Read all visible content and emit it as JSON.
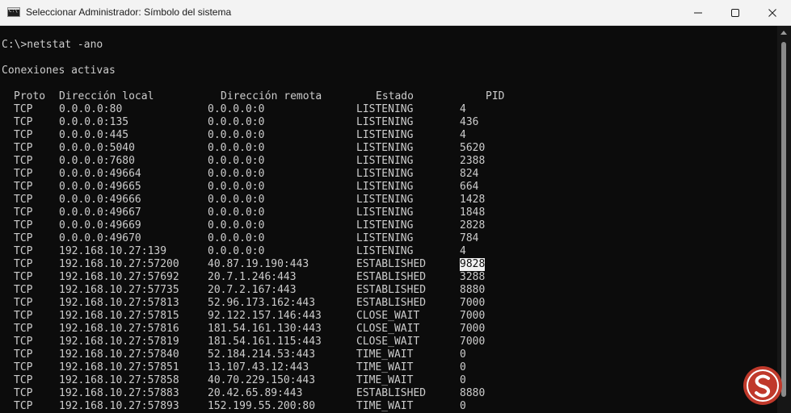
{
  "window": {
    "title": "Seleccionar Administrador: Símbolo del sistema",
    "minimize_icon": "minimize-icon",
    "maximize_icon": "maximize-icon",
    "close_icon": "close-icon"
  },
  "console": {
    "command_line": "C:\\>netstat -ano",
    "section_title": "Conexiones activas",
    "headers": {
      "proto": "Proto",
      "local": "Dirección local",
      "remote": "Dirección remota",
      "state": "Estado",
      "pid": "PID"
    },
    "rows": [
      {
        "proto": "TCP",
        "local": "0.0.0.0:80",
        "remote": "0.0.0.0:0",
        "state": "LISTENING",
        "pid": "4"
      },
      {
        "proto": "TCP",
        "local": "0.0.0.0:135",
        "remote": "0.0.0.0:0",
        "state": "LISTENING",
        "pid": "436"
      },
      {
        "proto": "TCP",
        "local": "0.0.0.0:445",
        "remote": "0.0.0.0:0",
        "state": "LISTENING",
        "pid": "4"
      },
      {
        "proto": "TCP",
        "local": "0.0.0.0:5040",
        "remote": "0.0.0.0:0",
        "state": "LISTENING",
        "pid": "5620"
      },
      {
        "proto": "TCP",
        "local": "0.0.0.0:7680",
        "remote": "0.0.0.0:0",
        "state": "LISTENING",
        "pid": "2388"
      },
      {
        "proto": "TCP",
        "local": "0.0.0.0:49664",
        "remote": "0.0.0.0:0",
        "state": "LISTENING",
        "pid": "824"
      },
      {
        "proto": "TCP",
        "local": "0.0.0.0:49665",
        "remote": "0.0.0.0:0",
        "state": "LISTENING",
        "pid": "664"
      },
      {
        "proto": "TCP",
        "local": "0.0.0.0:49666",
        "remote": "0.0.0.0:0",
        "state": "LISTENING",
        "pid": "1428"
      },
      {
        "proto": "TCP",
        "local": "0.0.0.0:49667",
        "remote": "0.0.0.0:0",
        "state": "LISTENING",
        "pid": "1848"
      },
      {
        "proto": "TCP",
        "local": "0.0.0.0:49669",
        "remote": "0.0.0.0:0",
        "state": "LISTENING",
        "pid": "2828"
      },
      {
        "proto": "TCP",
        "local": "0.0.0.0:49670",
        "remote": "0.0.0.0:0",
        "state": "LISTENING",
        "pid": "784"
      },
      {
        "proto": "TCP",
        "local": "192.168.10.27:139",
        "remote": "0.0.0.0:0",
        "state": "LISTENING",
        "pid": "4"
      },
      {
        "proto": "TCP",
        "local": "192.168.10.27:57200",
        "remote": "40.87.19.190:443",
        "state": "ESTABLISHED",
        "pid": "9828",
        "selected": true
      },
      {
        "proto": "TCP",
        "local": "192.168.10.27:57692",
        "remote": "20.7.1.246:443",
        "state": "ESTABLISHED",
        "pid": "3288"
      },
      {
        "proto": "TCP",
        "local": "192.168.10.27:57735",
        "remote": "20.7.2.167:443",
        "state": "ESTABLISHED",
        "pid": "8880"
      },
      {
        "proto": "TCP",
        "local": "192.168.10.27:57813",
        "remote": "52.96.173.162:443",
        "state": "ESTABLISHED",
        "pid": "7000"
      },
      {
        "proto": "TCP",
        "local": "192.168.10.27:57815",
        "remote": "92.122.157.146:443",
        "state": "CLOSE_WAIT",
        "pid": "7000"
      },
      {
        "proto": "TCP",
        "local": "192.168.10.27:57816",
        "remote": "181.54.161.130:443",
        "state": "CLOSE_WAIT",
        "pid": "7000"
      },
      {
        "proto": "TCP",
        "local": "192.168.10.27:57819",
        "remote": "181.54.161.115:443",
        "state": "CLOSE_WAIT",
        "pid": "7000"
      },
      {
        "proto": "TCP",
        "local": "192.168.10.27:57840",
        "remote": "52.184.214.53:443",
        "state": "TIME_WAIT",
        "pid": "0"
      },
      {
        "proto": "TCP",
        "local": "192.168.10.27:57851",
        "remote": "13.107.43.12:443",
        "state": "TIME_WAIT",
        "pid": "0"
      },
      {
        "proto": "TCP",
        "local": "192.168.10.27:57858",
        "remote": "40.70.229.150:443",
        "state": "TIME_WAIT",
        "pid": "0"
      },
      {
        "proto": "TCP",
        "local": "192.168.10.27:57883",
        "remote": "20.42.65.89:443",
        "state": "ESTABLISHED",
        "pid": "8880"
      },
      {
        "proto": "TCP",
        "local": "192.168.10.27:57893",
        "remote": "152.199.55.200:80",
        "state": "TIME_WAIT",
        "pid": "0"
      }
    ]
  },
  "colors": {
    "console_bg": "#0c0c0c",
    "console_text": "#cccccc",
    "titlebar_bg": "#f3f3f3",
    "selection_bg": "#f2f2f2",
    "watermark": "#c0392b"
  }
}
